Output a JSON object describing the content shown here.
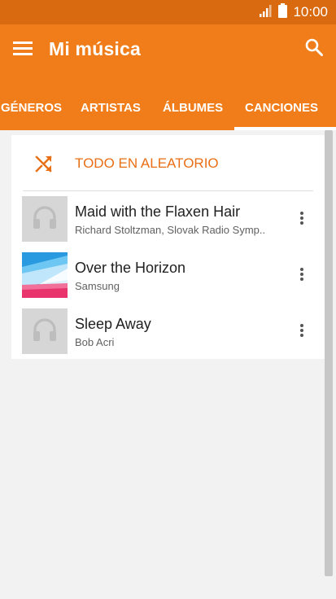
{
  "status": {
    "time": "10:00",
    "icons": [
      "signal-icon",
      "battery-icon"
    ]
  },
  "appbar": {
    "title": "Mi música",
    "menu_icon": "menu-icon",
    "search_icon": "search-icon"
  },
  "tabs": [
    {
      "label": "GÉNEROS",
      "active": false
    },
    {
      "label": "ARTISTAS",
      "active": false
    },
    {
      "label": "ÁLBUMES",
      "active": false
    },
    {
      "label": "CANCIONES",
      "active": true
    }
  ],
  "shuffle": {
    "label": "TODO EN ALEATORIO",
    "icon": "shuffle-icon"
  },
  "songs": [
    {
      "title": "Maid with the Flaxen Hair",
      "artist": "Richard Stoltzman, Slovak Radio Symp..",
      "cover": "placeholder"
    },
    {
      "title": "Over the Horizon",
      "artist": "Samsung",
      "cover": "art"
    },
    {
      "title": "Sleep Away",
      "artist": "Bob Acri",
      "cover": "placeholder"
    }
  ],
  "colors": {
    "status_bar": "#d96a10",
    "app_bar": "#f07d19",
    "accent": "#e86f16",
    "background": "#f2f2f2"
  }
}
